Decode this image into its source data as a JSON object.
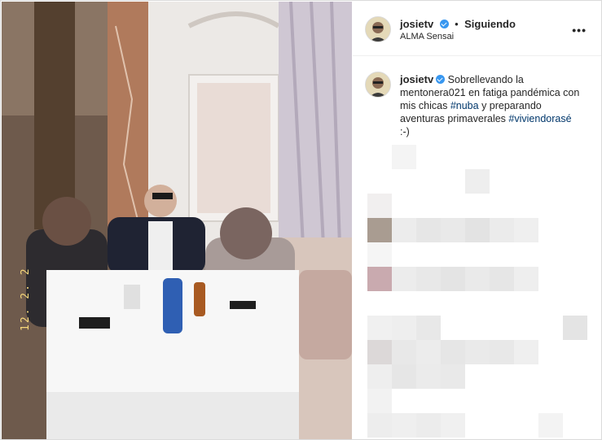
{
  "post": {
    "username": "josietv",
    "follow_status": "Siguiendo",
    "location": "ALMA Sensai",
    "caption_user": "josietv",
    "caption_text_1": "Sobrellevando la mentonera021 en fatiga pandémica con mis chicas ",
    "hashtag_1": "#nuba",
    "caption_text_2": " y preparando aventuras primaverales ",
    "hashtag_2": "#viviendorasé",
    "caption_text_3": " :-)",
    "photo_date_stamp": "12. 2. 2"
  },
  "colors": {
    "accent_blue": "#3897f0",
    "hashtag_link": "#00376b",
    "border": "#dbdbdb"
  },
  "icons": {
    "verified": "verified-badge-icon",
    "more": "more-options-icon"
  }
}
